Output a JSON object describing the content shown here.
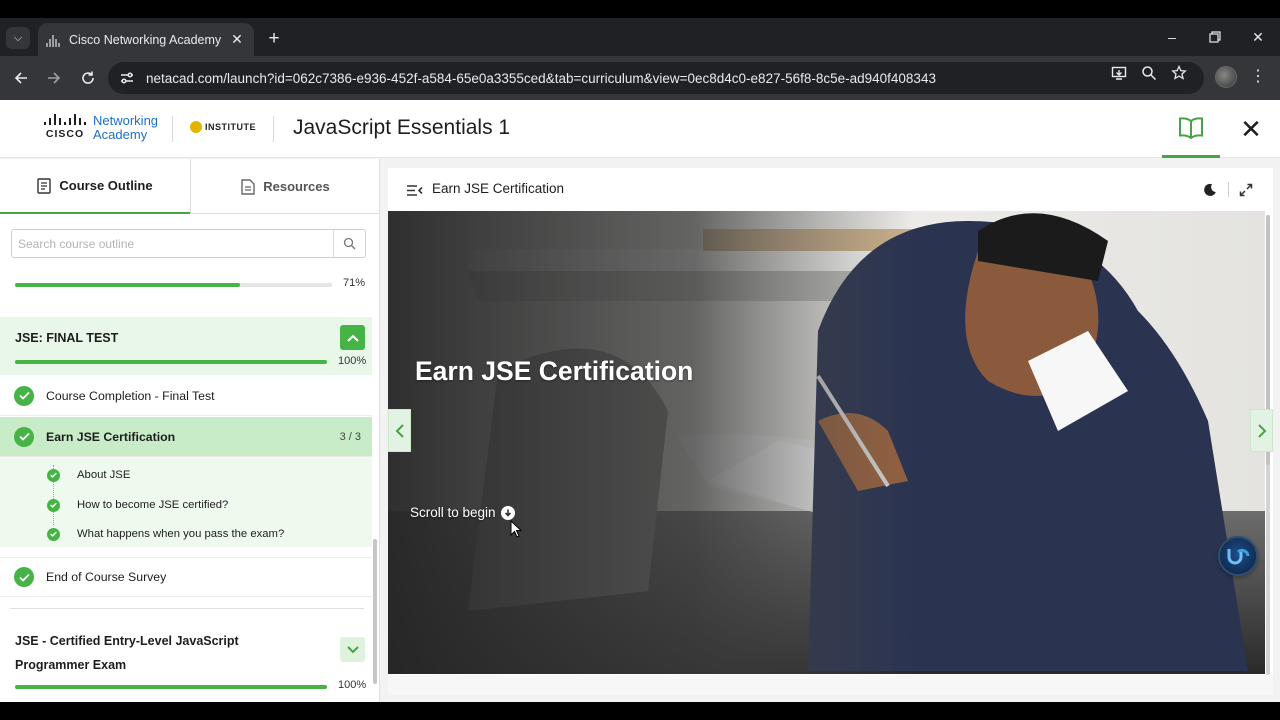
{
  "browser": {
    "tab_title": "Cisco Networking Academy",
    "url": "netacad.com/launch?id=062c7386-e936-452f-a584-65e0a3355ced&tab=curriculum&view=0ec8d4c0-e827-56f8-8c5e-ad940f408343"
  },
  "header": {
    "logo_word": "CISCO",
    "brand_line1": "Networking",
    "brand_line2": "Academy",
    "institute": "INSTITUTE",
    "course_title": "JavaScript Essentials 1"
  },
  "sidebar": {
    "tabs": [
      {
        "label": "Course Outline",
        "icon": "document-icon",
        "active": true
      },
      {
        "label": "Resources",
        "icon": "page-icon",
        "active": false
      }
    ],
    "search": {
      "placeholder": "Search course outline",
      "value": ""
    },
    "top_progress": {
      "value": 71,
      "label": "71%"
    },
    "final_test": {
      "title": "JSE: FINAL TEST",
      "progress": {
        "value": 100,
        "label": "100%"
      },
      "expanded": true,
      "items": [
        {
          "label": "Course Completion - Final Test",
          "completed": true,
          "active": false
        },
        {
          "label": "Earn JSE Certification",
          "completed": true,
          "active": true,
          "count": "3 / 3",
          "subitems": [
            {
              "label": "About JSE",
              "completed": true
            },
            {
              "label": "How to become JSE certified?",
              "completed": true
            },
            {
              "label": "What happens when you pass the exam?",
              "completed": true
            }
          ]
        },
        {
          "label": "End of Course Survey",
          "completed": true,
          "active": false
        }
      ]
    },
    "exam": {
      "title": "JSE - Certified Entry-Level JavaScript Programmer Exam",
      "progress": {
        "value": 100,
        "label": "100%"
      },
      "expanded": false
    }
  },
  "content": {
    "title": "Earn JSE Certification",
    "hero_title": "Earn JSE Certification",
    "scroll_hint": "Scroll to begin"
  },
  "colors": {
    "accent_green": "#46b346",
    "active_row": "#c7ecc7",
    "link_blue": "#1e6fc7"
  }
}
